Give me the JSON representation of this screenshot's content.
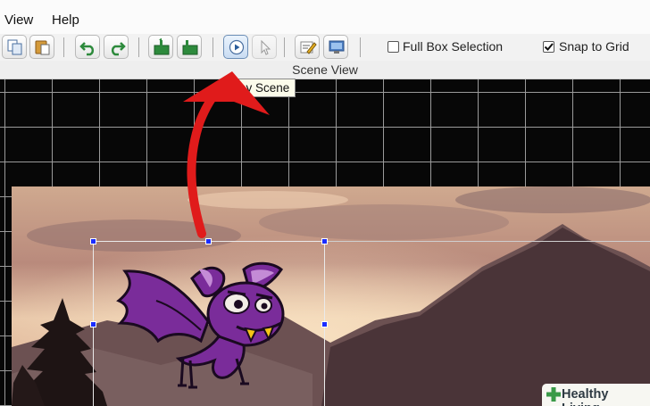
{
  "menu": {
    "view": "View",
    "help": "Help"
  },
  "toolbar": {
    "full_box_selection_label": "Full Box Selection",
    "full_box_selection_checked": false,
    "snap_to_grid_label": "Snap to Grid",
    "snap_to_grid_checked": true
  },
  "scene_header": {
    "title": "Scene View"
  },
  "tooltip": {
    "text": "ay Scene"
  },
  "watermark": {
    "brand": "Healthy Living"
  },
  "colors": {
    "annotation_arrow": "#e01b1b",
    "selection_handle": "#1a2cff",
    "accent_green": "#2d8a3c"
  }
}
